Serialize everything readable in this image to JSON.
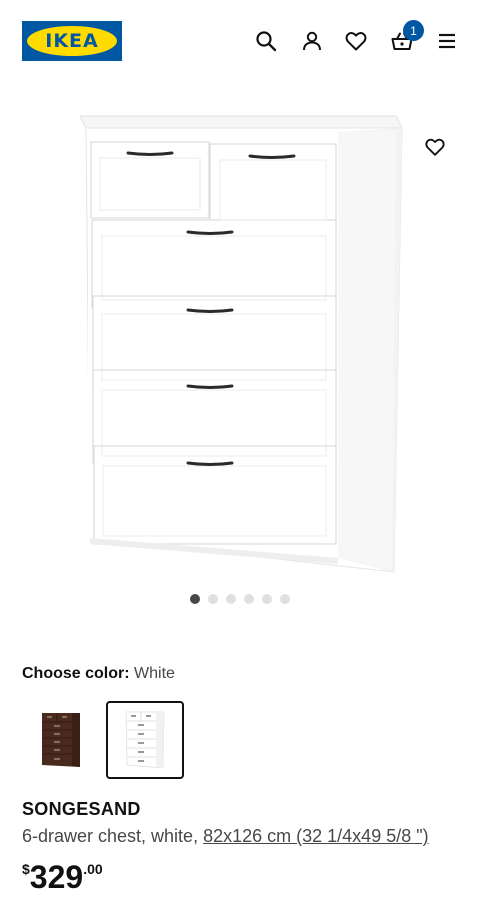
{
  "header": {
    "logo_text": "IKEA",
    "icons": [
      "search-icon",
      "account-icon",
      "favorites-icon",
      "cart-icon",
      "menu-icon"
    ],
    "cart_count": "1"
  },
  "product": {
    "image_icon": "dresser-product-image",
    "wishlist_icon": "heart-icon",
    "carousel": {
      "total": 6,
      "active_index": 0
    },
    "color": {
      "label": "Choose color:",
      "selected": "White",
      "options": [
        {
          "swatch": "brown-dresser-thumbnail",
          "selected": false
        },
        {
          "swatch": "white-dresser-thumbnail",
          "selected": true
        }
      ]
    },
    "name": "SONGESAND",
    "description": "6-drawer chest, white,",
    "dimensions": "82x126 cm (32 1/4x49 5/8 \")",
    "price": {
      "currency": "$",
      "integer": "329",
      "decimal": ".00"
    }
  },
  "colors": {
    "brand_blue": "#0058a3",
    "brand_yellow": "#ffdb00",
    "text": "#111111",
    "muted_text": "#484848"
  }
}
